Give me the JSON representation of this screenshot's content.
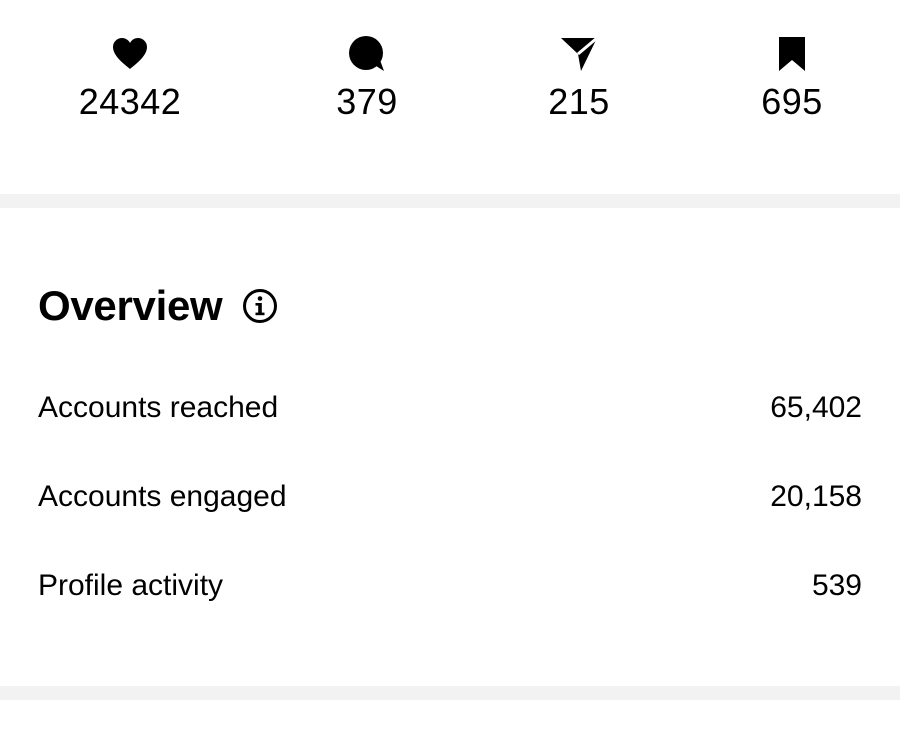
{
  "engagement": {
    "likes": {
      "icon": "heart-icon",
      "value": "24342"
    },
    "comments": {
      "icon": "comment-bubble-icon",
      "value": "379"
    },
    "shares": {
      "icon": "paper-plane-icon",
      "value": "215"
    },
    "saves": {
      "icon": "bookmark-icon",
      "value": "695"
    }
  },
  "overview": {
    "title": "Overview",
    "info_icon": "info-icon",
    "metrics": [
      {
        "label": "Accounts reached",
        "value": "65,402"
      },
      {
        "label": "Accounts engaged",
        "value": "20,158"
      },
      {
        "label": "Profile activity",
        "value": "539"
      }
    ]
  },
  "colors": {
    "text": "#000000",
    "background": "#ffffff",
    "divider": "#f2f2f2"
  }
}
